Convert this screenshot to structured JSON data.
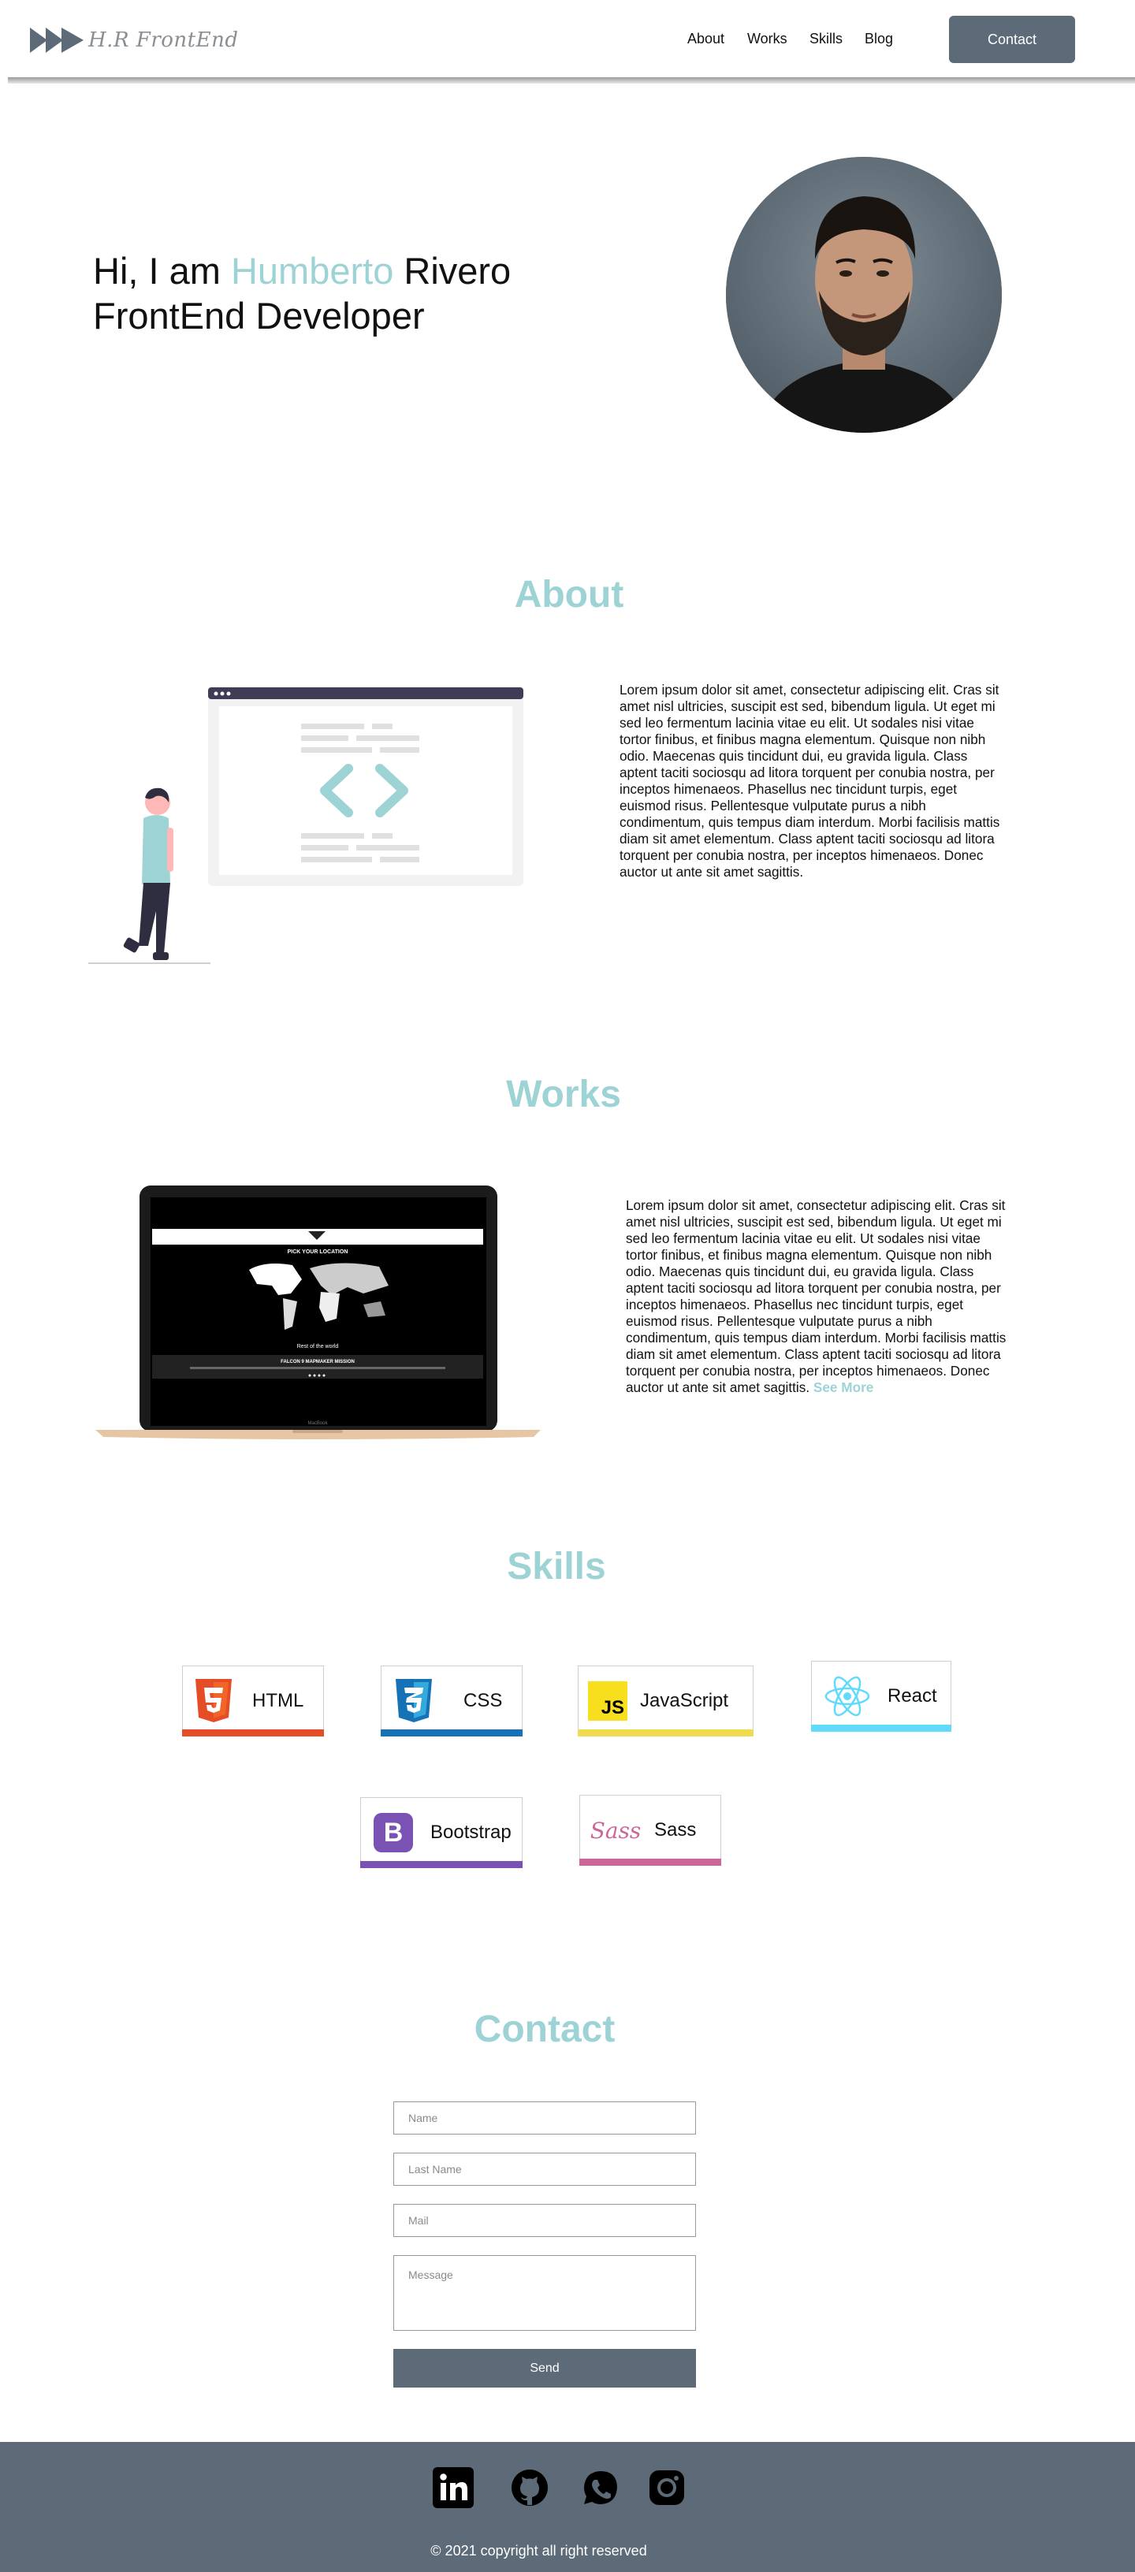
{
  "nav": {
    "logo_text": "H.R FrontEnd",
    "links": [
      "About",
      "Works",
      "Skills",
      "Blog"
    ],
    "contact_label": "Contact"
  },
  "hero": {
    "greeting": "Hi,  I am ",
    "first_name": "Humberto",
    "last_name": " Rivero",
    "role": "FrontEnd Developer"
  },
  "about": {
    "title": "About",
    "text": "Lorem ipsum dolor sit amet, consectetur adipiscing elit. Cras sit amet nisl ultricies, suscipit est sed, bibendum ligula. Ut eget mi sed leo fermentum lacinia vitae eu elit. Ut sodales nisi vitae tortor finibus, et finibus magna elementum. Quisque non nibh odio. Maecenas quis tincidunt dui, eu gravida ligula. Class aptent taciti sociosqu ad litora torquent per conubia nostra, per inceptos himenaeos. Phasellus nec tincidunt turpis, eget euismod risus. Pellentesque vulputate purus a nibh condimentum, quis tempus diam interdum. Morbi facilisis mattis diam sit amet elementum. Class aptent taciti sociosqu ad litora torquent per conubia nostra, per inceptos himenaeos. Donec auctor ut ante sit amet sagittis."
  },
  "works": {
    "title": "Works",
    "text": "Lorem ipsum dolor sit amet, consectetur adipiscing elit. Cras sit amet nisl ultricies, suscipit est sed, bibendum ligula. Ut eget mi sed leo fermentum lacinia vitae eu elit. Ut sodales nisi vitae tortor finibus, et finibus magna elementum. Quisque non nibh odio. Maecenas quis tincidunt dui, eu gravida ligula. Class aptent taciti sociosqu ad litora torquent per conubia nostra, per inceptos himenaeos. Phasellus nec tincidunt turpis, eget euismod risus. Pellentesque vulputate purus a nibh condimentum, quis tempus diam interdum. Morbi facilisis mattis diam sit amet elementum. Class aptent taciti sociosqu ad litora torquent per conubia nostra, per inceptos himenaeos. Donec auctor ut ante sit amet sagittis.",
    "see_more": "See More",
    "screen_header": "PICK YOUR LOCATION",
    "screen_caption": "Rest of the world",
    "screen_mission": "FALCON 9 MAPMAKER MISSION",
    "laptop_brand": "MacBook"
  },
  "skills": {
    "title": "Skills",
    "items": [
      {
        "label": "HTML",
        "icon": "html5-icon",
        "color": "#e44d26"
      },
      {
        "label": "CSS",
        "icon": "css3-icon",
        "color": "#1572b6"
      },
      {
        "label": "JavaScript",
        "icon": "javascript-icon",
        "color": "#f0db4f"
      },
      {
        "label": "React",
        "icon": "react-icon",
        "color": "#61dafb"
      },
      {
        "label": "Bootstrap",
        "icon": "bootstrap-icon",
        "color": "#7952b3"
      },
      {
        "label": "Sass",
        "icon": "sass-icon",
        "color": "#cc6699"
      }
    ],
    "js_badge": "JS",
    "bootstrap_badge": "B",
    "sass_badge": "Sass"
  },
  "contact": {
    "title": "Contact",
    "name_placeholder": "Name",
    "lastname_placeholder": "Last Name",
    "mail_placeholder": "Mail",
    "message_placeholder": "Message",
    "send_label": "Send"
  },
  "footer": {
    "social": [
      "linkedin-icon",
      "github-icon",
      "whatsapp-icon",
      "instagram-icon"
    ],
    "copyright": "© 2021 copyright all right reserved"
  },
  "colors": {
    "accent": "#9dd3d5",
    "slate": "#5c6b77"
  }
}
